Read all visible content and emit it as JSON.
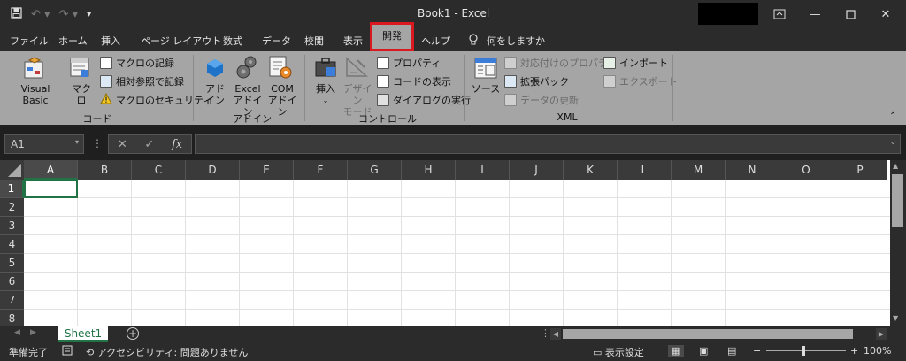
{
  "window": {
    "title": "Book1  -  Excel"
  },
  "tabs": [
    "ファイル",
    "ホーム",
    "挿入",
    "ページ レイアウト",
    "数式",
    "データ",
    "校閲",
    "表示",
    "開発",
    "ヘルプ"
  ],
  "tell_me": "何をしますか",
  "ribbon": {
    "code": {
      "label": "コード",
      "visual_basic": "Visual Basic",
      "macro": "マクロ",
      "record_macro": "マクロの記録",
      "relative_ref": "相対参照で記録",
      "macro_security": "マクロのセキュリティ"
    },
    "addins": {
      "label": "アドイン",
      "addin_1": "アド",
      "addin_2": "イン",
      "excel_1": "Excel",
      "excel_2": "アドイン",
      "com_1": "COM",
      "com_2": "アドイン"
    },
    "controls": {
      "label": "コントロール",
      "insert": "挿入",
      "design_1": "デザイン",
      "design_2": "モード",
      "properties": "プロパティ",
      "view_code": "コードの表示",
      "run_dialog": "ダイアログの実行"
    },
    "xml": {
      "label": "XML",
      "source": "ソース",
      "map_props": "対応付けのプロパティ",
      "expansion": "拡張パック",
      "refresh": "データの更新",
      "import": "インポート",
      "export": "エクスポート"
    }
  },
  "formula_bar": {
    "name_box": "A1",
    "fx": "fx"
  },
  "columns": [
    "A",
    "B",
    "C",
    "D",
    "E",
    "F",
    "G",
    "H",
    "I",
    "J",
    "K",
    "L",
    "M",
    "N",
    "O",
    "P"
  ],
  "rows": [
    "1",
    "2",
    "3",
    "4",
    "5",
    "6",
    "7",
    "8"
  ],
  "sheet": {
    "name": "Sheet1"
  },
  "status": {
    "ready": "準備完了",
    "accessibility": "アクセシビリティ: 問題ありません",
    "display_settings": "表示設定",
    "zoom": "100%"
  }
}
